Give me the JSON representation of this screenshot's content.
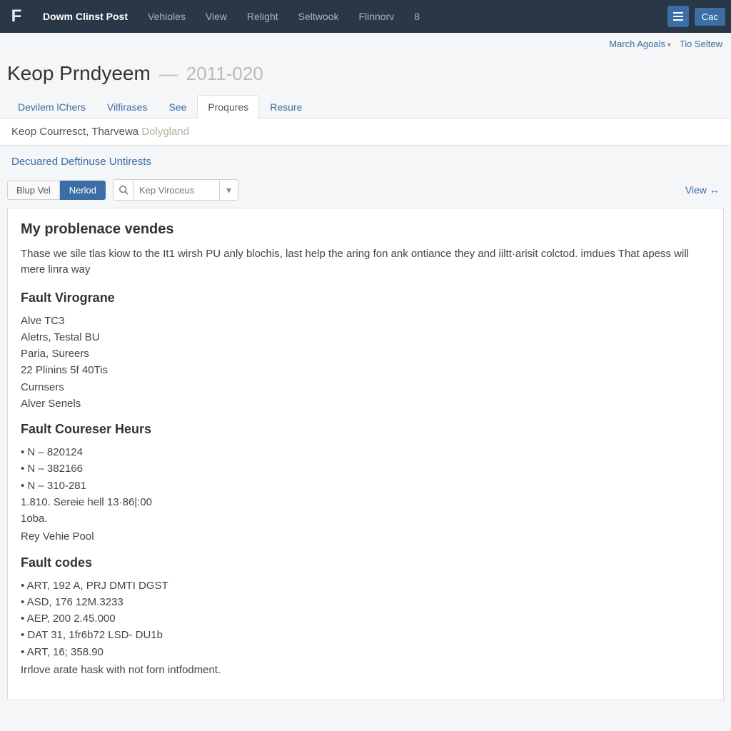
{
  "topbar": {
    "logo": "F",
    "items": [
      "Dowm Clinst Post",
      "Vehioles",
      "View",
      "Relight",
      "Seltwook",
      "Flinnorv",
      "8"
    ],
    "active_index": 0,
    "right_button": "Cac"
  },
  "subheader": {
    "left": "March Agoals",
    "right": "Tio Seltew"
  },
  "page": {
    "title": "Keop Prndyeem",
    "separator": "—",
    "code": "2011-020"
  },
  "tabs": {
    "items": [
      "Devilem lChers",
      "Vilfirases",
      "See",
      "Proqures",
      "Resure"
    ],
    "active_index": 3
  },
  "infobar": {
    "prefix": "Keop Courresct, Tharvewa",
    "suffix": "Dolygland"
  },
  "section_link": "Decuared Deftinuse Untirests",
  "toolbar": {
    "btn1": "Blup Vel",
    "btn2": "Nerlod",
    "search_placeholder": "Kep Viroceus",
    "view_label": "View"
  },
  "content": {
    "heading": "My problenace vendes",
    "paragraph": "Thase we sile tlas kiow to the It1 wirsh PU anly blochis, last help the aring fon ank ontiance they and iiltt·arisit colctod. imdues That apess will mere linra way",
    "section1": {
      "title": "Fault Virograne",
      "lines": [
        "Alve TC3",
        "Aletrs, Testal BU",
        "Paria, Sureers",
        "22 Plinins 5f 40Tis",
        "Curnsers",
        "Alver Senels"
      ]
    },
    "section2": {
      "title": "Fault Coureser Heurs",
      "bullets": [
        "N – 820124",
        "N – 382166",
        "N – 310-281"
      ],
      "after": [
        "1.810. Sereie hell 13·86|:00",
        "1oba."
      ],
      "footer": "Rey Vehie Pool"
    },
    "section3": {
      "title": "Fault codes",
      "bullets": [
        "ART, 192 A, PRJ DMTI DGST",
        "ASD, 176 12M.3233",
        "AEP, 200 2.45.000",
        "DAT 31, 1fr6b72 LSD- DU1b",
        "ART, 16; 358.90"
      ],
      "footer": "Irrlove arate hask with not forn intfodment."
    }
  }
}
